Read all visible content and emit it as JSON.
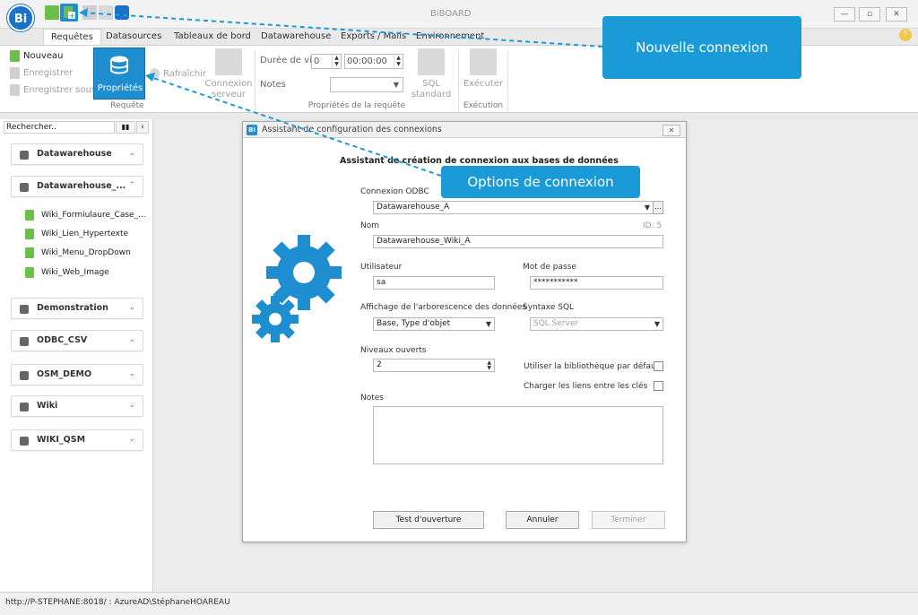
{
  "window": {
    "title": "BiBOARD",
    "logo_text": "Bi",
    "help_glyph": "?"
  },
  "ribbon_tabs": [
    "Requêtes",
    "Datasources",
    "Tableaux de bord",
    "Datawarehouse",
    "Exports / Mails",
    "Environnement"
  ],
  "ribbon": {
    "requete": {
      "nouveau": "Nouveau",
      "enregistrer": "Enregistrer",
      "enregistrer_sous": "Enregistrer sous",
      "proprietes": "Propriétés",
      "rafraichir": "Rafraîchir",
      "connexion_serveur": "Connexion serveur",
      "group_label": "Requête"
    },
    "proprietes_requete": {
      "duree_de_vie_label": "Durée de vie",
      "duree_de_vie_value": "0",
      "duree_time_value": "00:00:00",
      "notes_label": "Notes",
      "notes_value": "",
      "sql_standard": "SQL standard",
      "group_label": "Propriétés de la requête"
    },
    "execution": {
      "executer": "Exécuter",
      "group_label": "Exécution"
    }
  },
  "sidebar": {
    "search_value": "Rechercher..",
    "datasources": [
      {
        "label": "Datawarehouse",
        "chevron": "⌄"
      },
      {
        "label": "Datawarehouse_...",
        "chevron": "⌃"
      }
    ],
    "documents": [
      "Wiki_Formiulaure_Case_...",
      "Wiki_Lien_Hypertexte",
      "Wiki_Menu_DropDown",
      "Wiki_Web_Image"
    ],
    "more_datasources": [
      {
        "label": "Demonstration",
        "chevron": "⌄"
      },
      {
        "label": "ODBC_CSV",
        "chevron": "⌄"
      },
      {
        "label": "OSM_DEMO",
        "chevron": "⌄"
      },
      {
        "label": "Wiki",
        "chevron": "⌄"
      },
      {
        "label": "WIKI_QSM",
        "chevron": "⌄"
      }
    ]
  },
  "dialog": {
    "title": "Assistant de configuration des connexions",
    "close_glyph": "✕",
    "heading": "Assistant de création de connexion aux bases de données",
    "odbc_label": "Connexion ODBC",
    "odbc_value": "Datawarehouse_A",
    "ellipsis": "...",
    "nom_label": "Nom",
    "id_label": "ID: 5",
    "nom_value": "Datawarehouse_Wiki_A",
    "utilisateur_label": "Utilisateur",
    "utilisateur_value": "sa",
    "mot_de_passe_label": "Mot de passe",
    "mot_de_passe_value": "***********",
    "affichage_label": "Affichage de l'arborescence des données",
    "affichage_value": "Base, Type d'objet",
    "syntaxe_label": "Syntaxe SQL",
    "syntaxe_value": "SQL Server",
    "niveaux_label": "Niveaux ouverts",
    "niveaux_value": "2",
    "bibliotheque_label": "Utiliser la bibliothèque par défaut",
    "liens_label": "Charger les liens entre les clés",
    "notes_label": "Notes",
    "notes_value": "",
    "btn_test": "Test d'ouverture",
    "btn_annuler": "Annuler",
    "btn_terminer": "Terminer"
  },
  "status_bar": {
    "text": "http://P-STEPHANE:8018/ : AzureAD\\StéphaneHOAREAU"
  },
  "callouts": {
    "nouvelle_connexion": "Nouvelle connexion",
    "options_de_connexion": "Options de connexion"
  },
  "colors": {
    "accent": "#1f8ed1",
    "callout": "#1a9bd7",
    "doc_icon": "#6cc04a"
  },
  "icons": [
    "new-document-icon",
    "new-connection-icon",
    "save-icon",
    "print-icon",
    "database-icon",
    "binoculars-icon",
    "gear-icon",
    "close-icon",
    "help-icon",
    "lightning-icon"
  ]
}
